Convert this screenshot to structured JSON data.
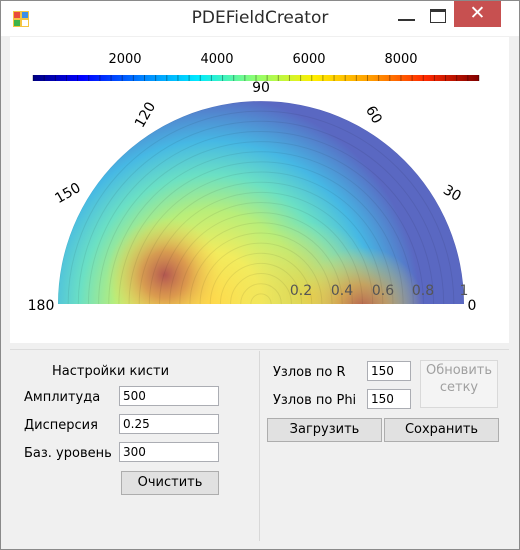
{
  "window": {
    "title": "PDEFieldCreator",
    "close_glyph": "✕"
  },
  "colorbar": {
    "ticks": [
      "2000",
      "4000",
      "6000",
      "8000"
    ],
    "colors": [
      "#000080",
      "#0000ff",
      "#0080ff",
      "#00e5ff",
      "#80ff80",
      "#ffff00",
      "#ff9900",
      "#ff2000",
      "#800000"
    ]
  },
  "polar": {
    "angle_labels": [
      "180",
      "150",
      "120",
      "90",
      "60",
      "30",
      "0"
    ],
    "radius_labels": [
      "0.2",
      "0.4",
      "0.6",
      "0.8",
      "1"
    ]
  },
  "brush": {
    "heading": "Настройки кисти",
    "amplitude_label": "Амплитуда",
    "amplitude_value": "500",
    "dispersion_label": "Дисперсия",
    "dispersion_value": "0.25",
    "base_label": "Баз. уровень",
    "base_value": "300",
    "clear_label": "Очистить"
  },
  "grid": {
    "nodes_r_label": "Узлов по R",
    "nodes_r_value": "150",
    "nodes_phi_label": "Узлов по Phi",
    "nodes_phi_value": "150",
    "update_label_line1": "Обновить",
    "update_label_line2": "сетку",
    "load_label": "Загрузить",
    "save_label": "Сохранить"
  }
}
